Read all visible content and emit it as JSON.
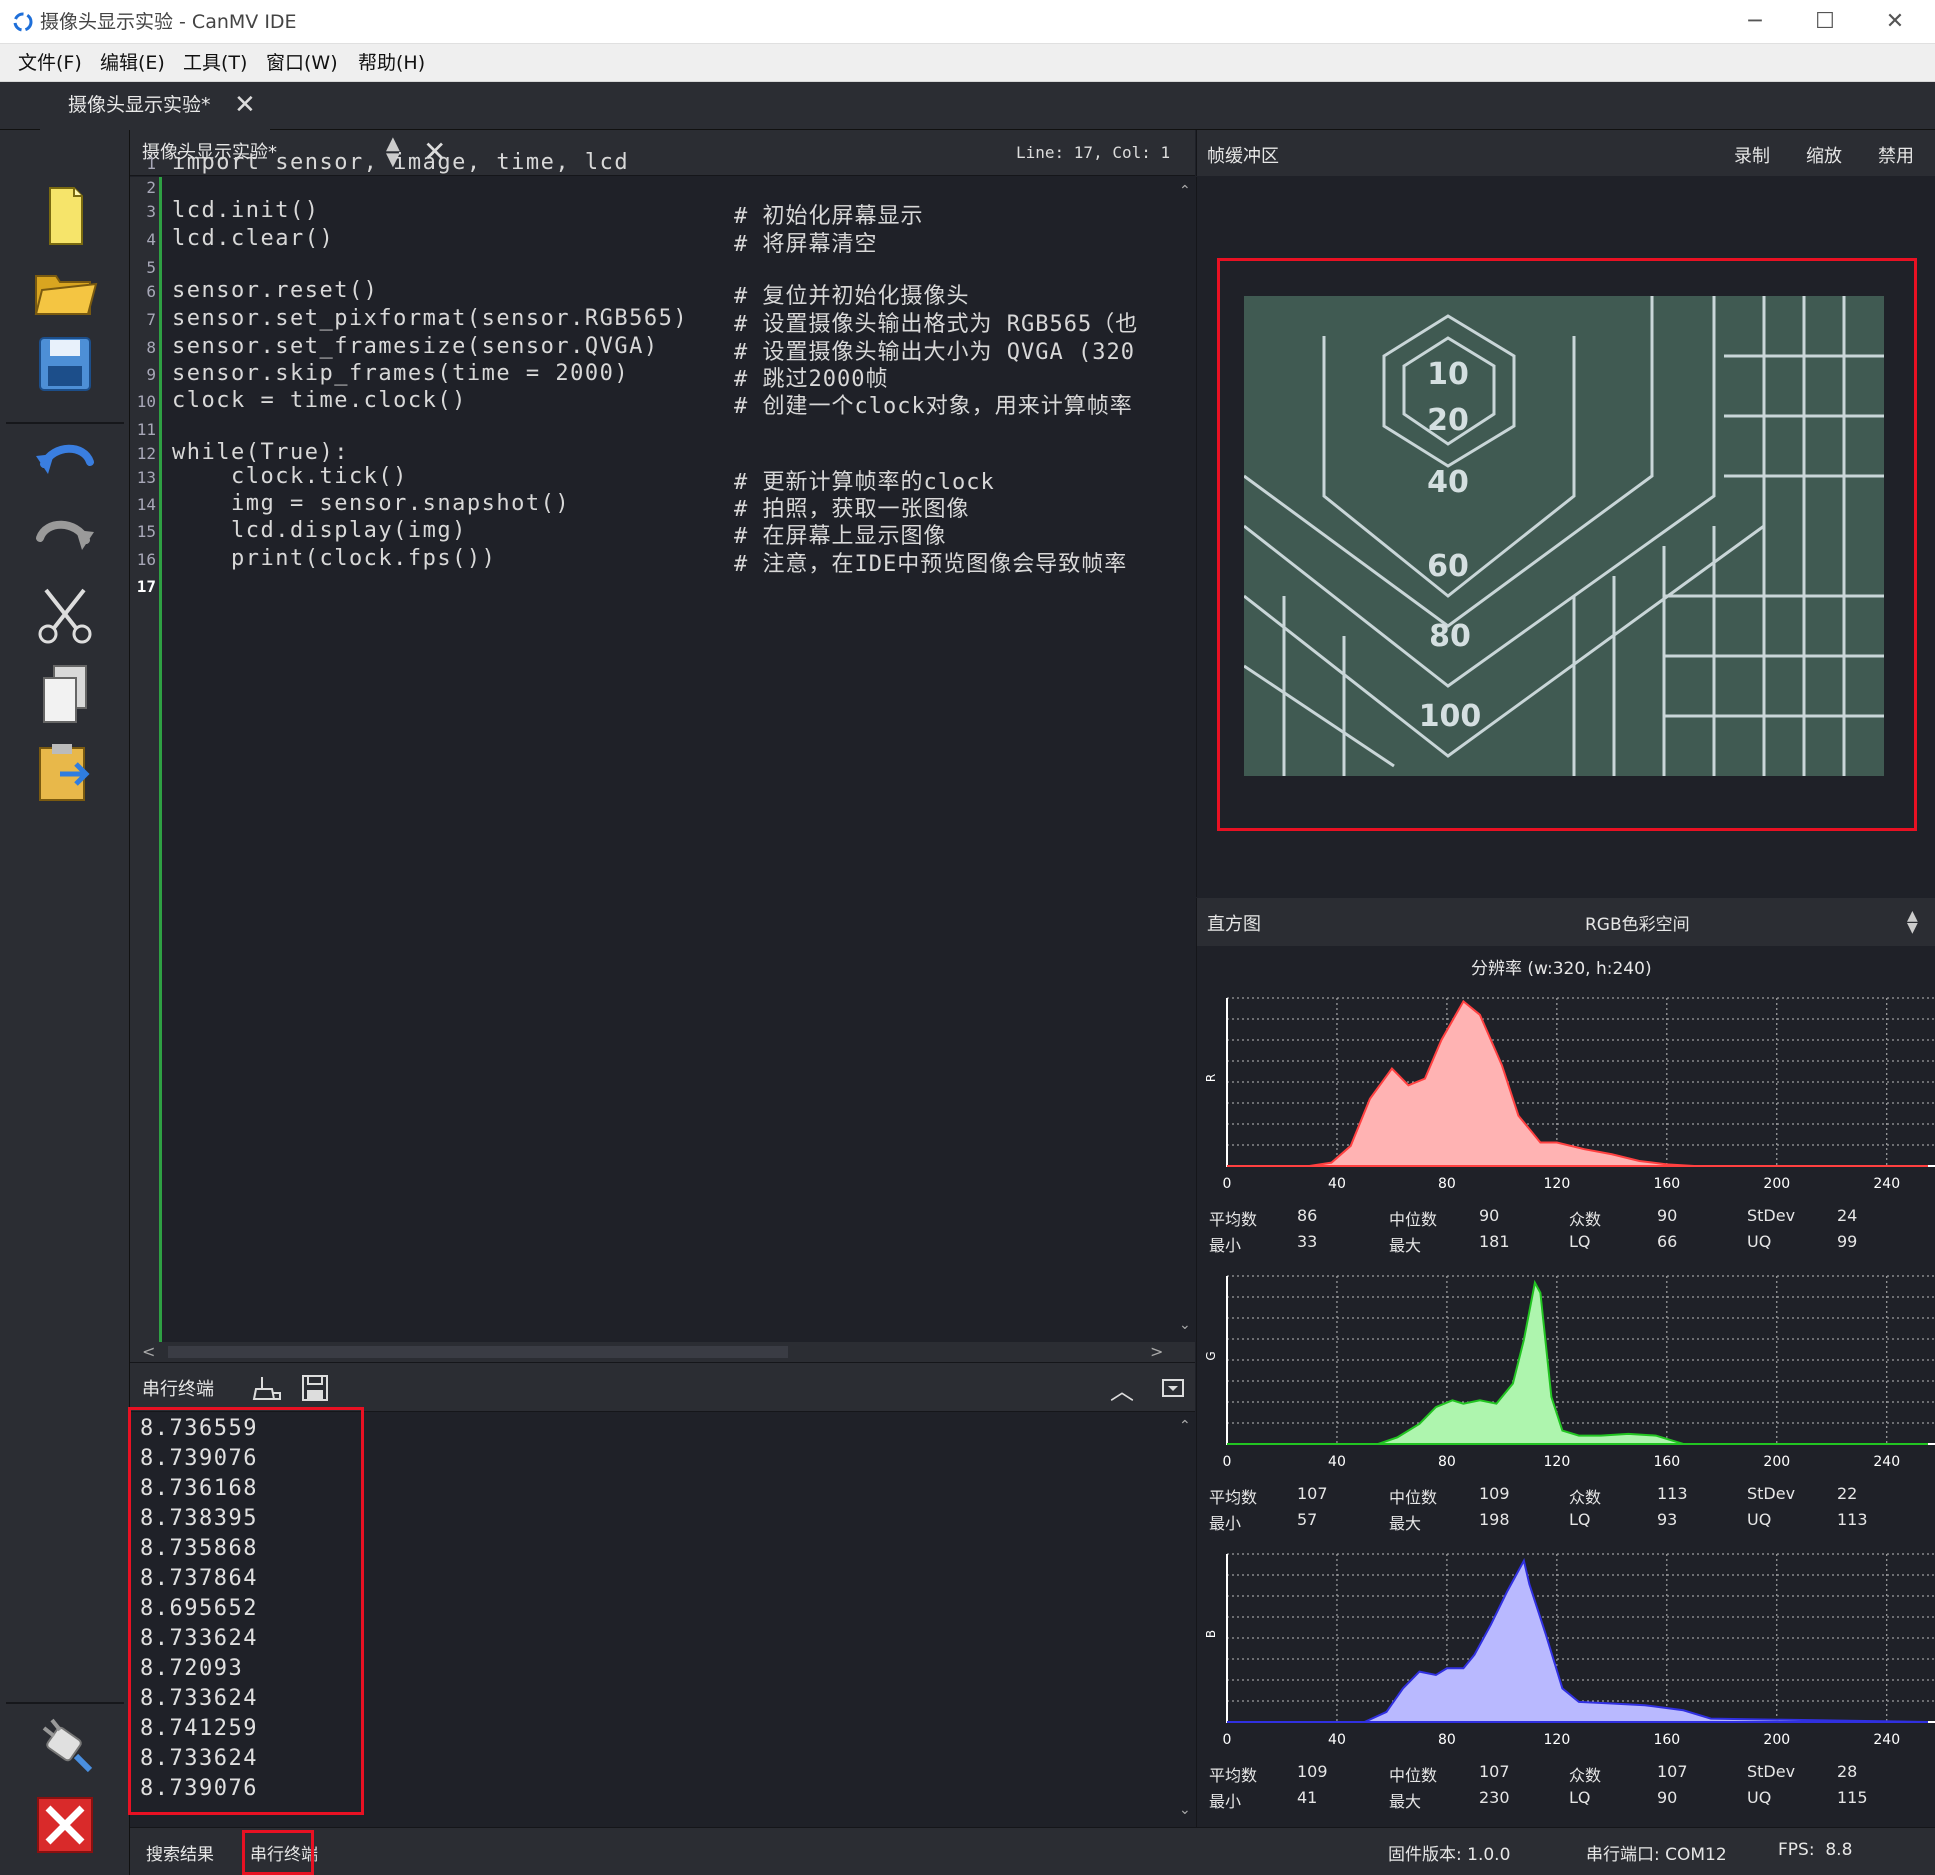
{
  "window": {
    "title": "摄像头显示实验 - CanMV IDE"
  },
  "menu": [
    "文件(F)",
    "编辑(E)",
    "工具(T)",
    "窗口(W)",
    "帮助(H)"
  ],
  "doc_tab": {
    "label": "摄像头显示实验*"
  },
  "editor": {
    "file_name": "摄像头显示实验*",
    "cursor": "Line: 17, Col: 1",
    "current_line": 17,
    "lines": [
      {
        "n": "1",
        "code": "import sensor, image, time, lcd",
        "comment": ""
      },
      {
        "n": "2",
        "code": "",
        "comment": ""
      },
      {
        "n": "3",
        "code": "lcd.init()",
        "comment": "# 初始化屏幕显示"
      },
      {
        "n": "4",
        "code": "lcd.clear()",
        "comment": "# 将屏幕清空"
      },
      {
        "n": "5",
        "code": "",
        "comment": ""
      },
      {
        "n": "6",
        "code": "sensor.reset()",
        "comment": "# 复位并初始化摄像头"
      },
      {
        "n": "7",
        "code": "sensor.set_pixformat(sensor.RGB565)",
        "comment": "# 设置摄像头输出格式为 RGB565（也"
      },
      {
        "n": "8",
        "code": "sensor.set_framesize(sensor.QVGA)",
        "comment": "# 设置摄像头输出大小为 QVGA (320"
      },
      {
        "n": "9",
        "code": "sensor.skip_frames(time = 2000)",
        "comment": "# 跳过2000帧"
      },
      {
        "n": "10",
        "code": "clock = time.clock()",
        "comment": "# 创建一个clock对象，用来计算帧率"
      },
      {
        "n": "11",
        "code": "",
        "comment": ""
      },
      {
        "n": "12",
        "code": "while(True):",
        "comment": ""
      },
      {
        "n": "13",
        "code": "    clock.tick()",
        "comment": "# 更新计算帧率的clock"
      },
      {
        "n": "14",
        "code": "    img = sensor.snapshot()",
        "comment": "# 拍照，获取一张图像"
      },
      {
        "n": "15",
        "code": "    lcd.display(img)",
        "comment": "# 在屏幕上显示图像"
      },
      {
        "n": "16",
        "code": "    print(clock.fps())",
        "comment": "# 注意，在IDE中预览图像会导致帧率"
      },
      {
        "n": "17",
        "code": "",
        "comment": ""
      }
    ]
  },
  "terminal": {
    "title": "串行终端",
    "lines": [
      "8.736559",
      "8.739076",
      "8.736168",
      "8.738395",
      "8.735868",
      "8.737864",
      "8.695652",
      "8.733624",
      "8.72093",
      "8.733624",
      "8.741259",
      "8.733624",
      "8.739076"
    ]
  },
  "status": {
    "search_results": "搜索结果",
    "serial_terminal": "串行终端",
    "firmware": "固件版本: 1.0.0",
    "port": "串行端口: COM12",
    "fps": "FPS:  8.8"
  },
  "framebuffer": {
    "title": "帧缓冲区",
    "record": "录制",
    "zoom": "缩放",
    "disable": "禁用",
    "image_labels": [
      "10",
      "20",
      "40",
      "60",
      "80",
      "100"
    ]
  },
  "histogram": {
    "title": "直方图",
    "colorspace": "RGB色彩空间",
    "resolution": "分辨率 (w:320, h:240)",
    "axis_ticks": [
      "0",
      "40",
      "80",
      "120",
      "160",
      "200",
      "240"
    ],
    "stat_labels": {
      "mean": "平均数",
      "median": "中位数",
      "mode": "众数",
      "stdev": "StDev",
      "min": "最小",
      "max": "最大",
      "lq": "LQ",
      "uq": "UQ"
    },
    "channels": [
      {
        "name": "R",
        "color": "#ff4040",
        "fill": "#ffb3b3",
        "mean": "86",
        "median": "90",
        "mode": "90",
        "stdev": "24",
        "min": "33",
        "max": "181",
        "lq": "66",
        "uq": "99"
      },
      {
        "name": "G",
        "color": "#22c422",
        "fill": "#aef5ae",
        "mean": "107",
        "median": "109",
        "mode": "113",
        "stdev": "22",
        "min": "57",
        "max": "198",
        "lq": "93",
        "uq": "113"
      },
      {
        "name": "B",
        "color": "#3030e0",
        "fill": "#b9b9ff",
        "mean": "109",
        "median": "107",
        "mode": "107",
        "stdev": "28",
        "min": "41",
        "max": "230",
        "lq": "90",
        "uq": "115"
      }
    ]
  },
  "chart_data": [
    {
      "type": "area",
      "name": "R",
      "x": [
        0,
        30,
        38,
        45,
        52,
        60,
        66,
        72,
        78,
        86,
        92,
        100,
        106,
        114,
        120,
        130,
        140,
        150,
        160,
        170,
        255
      ],
      "values": [
        0,
        0,
        2,
        12,
        40,
        58,
        48,
        52,
        75,
        98,
        90,
        60,
        30,
        14,
        14,
        10,
        7,
        3,
        1,
        0,
        0
      ]
    },
    {
      "type": "area",
      "name": "G",
      "x": [
        0,
        55,
        62,
        70,
        76,
        82,
        86,
        92,
        98,
        104,
        108,
        112,
        114,
        118,
        122,
        128,
        136,
        146,
        156,
        166,
        255
      ],
      "values": [
        0,
        0,
        4,
        12,
        22,
        26,
        24,
        26,
        24,
        36,
        62,
        96,
        90,
        28,
        8,
        5,
        5,
        6,
        5,
        0,
        0
      ]
    },
    {
      "type": "area",
      "name": "B",
      "x": [
        0,
        50,
        58,
        64,
        70,
        76,
        80,
        86,
        90,
        96,
        102,
        108,
        110,
        116,
        122,
        128,
        140,
        152,
        166,
        176,
        255
      ],
      "values": [
        0,
        0,
        6,
        20,
        30,
        28,
        32,
        32,
        40,
        58,
        78,
        96,
        82,
        52,
        20,
        12,
        11,
        10,
        7,
        2,
        0
      ]
    }
  ]
}
